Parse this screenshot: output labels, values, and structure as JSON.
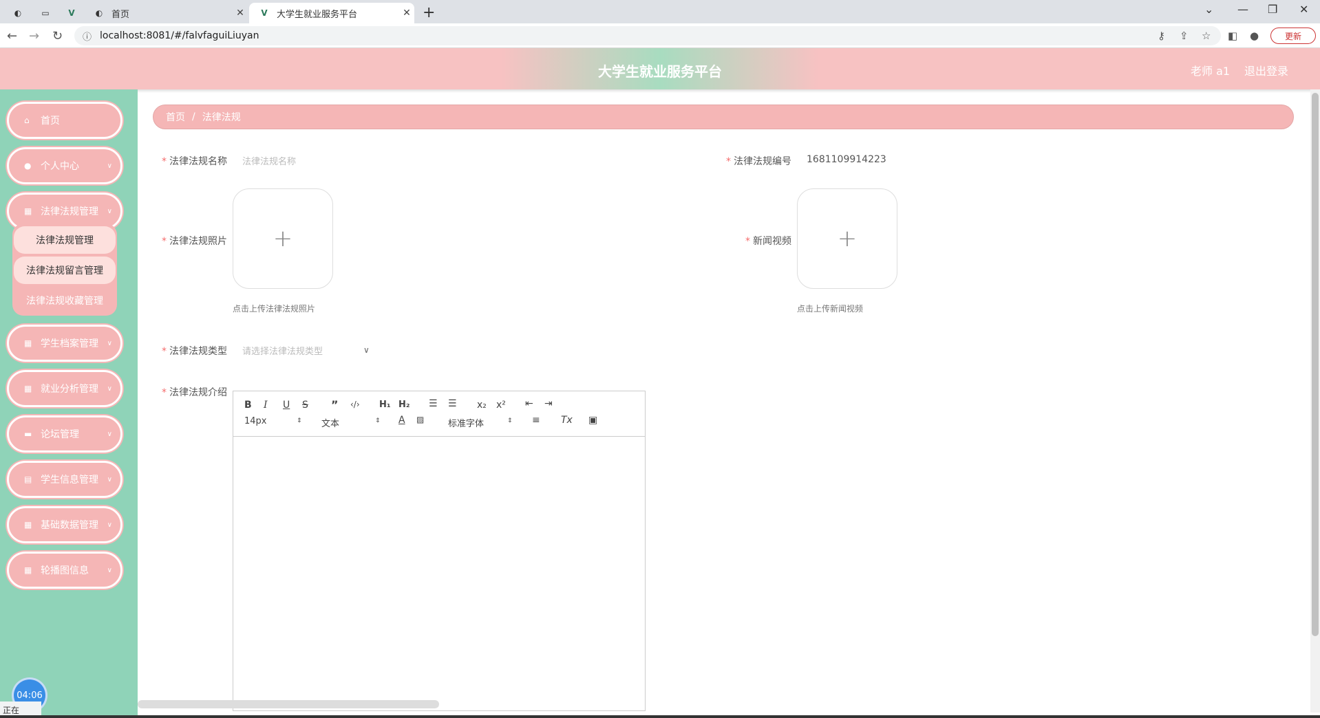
{
  "browser": {
    "tabs": [
      {
        "title": "首页"
      },
      {
        "title": "大学生就业服务平台"
      }
    ],
    "url": "localhost:8081/#/falvfaguiLiuyan",
    "update_label": "更新"
  },
  "header": {
    "title": "大学生就业服务平台",
    "user": "老师 a1",
    "logout": "退出登录"
  },
  "sidebar": {
    "items": [
      {
        "label": "首页"
      },
      {
        "label": "个人中心"
      },
      {
        "label": "法律法规管理"
      },
      {
        "label": "学生档案管理"
      },
      {
        "label": "就业分析管理"
      },
      {
        "label": "论坛管理"
      },
      {
        "label": "学生信息管理"
      },
      {
        "label": "基础数据管理"
      },
      {
        "label": "轮播图信息"
      }
    ],
    "submenu": [
      {
        "label": "法律法规管理"
      },
      {
        "label": "法律法规留言管理"
      },
      {
        "label": "法律法规收藏管理"
      }
    ],
    "clock": "04:06"
  },
  "breadcrumb": {
    "home": "首页",
    "current": "法律法规"
  },
  "form": {
    "name_label": "法律法规名称",
    "name_placeholder": "法律法规名称",
    "code_label": "法律法规编号",
    "code_value": "1681109914223",
    "photo_label": "法律法规照片",
    "photo_hint": "点击上传法律法规照片",
    "video_label": "新闻视频",
    "video_hint": "点击上传新闻视频",
    "type_label": "法律法规类型",
    "type_placeholder": "请选择法律法规类型",
    "intro_label": "法律法规介绍"
  },
  "editor": {
    "font_size": "14px",
    "header": "文本",
    "font": "标准字体"
  },
  "statusbar": {
    "text": "正在"
  }
}
